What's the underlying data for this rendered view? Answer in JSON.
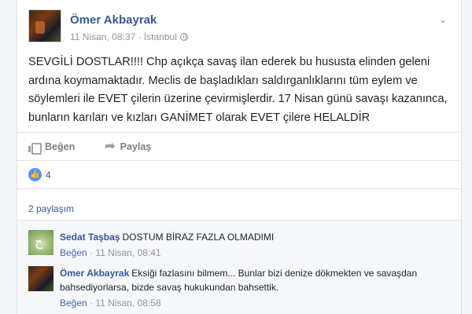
{
  "post": {
    "author": "Ömer Akbayrak",
    "timestamp": "11 Nisan, 08:37",
    "separator": " · ",
    "location": "İstanbul",
    "privacy_icon": "globe-icon",
    "body": "SEVGİLİ DOSTLAR!!!! Chp açıkça savaş ilan ederek bu hususta elinden geleni ardına koymamaktadır. Meclis de başladıkları saldırganlıklarını tüm eylem ve söylemleri ile EVET çilerin üzerine çevirmişlerdir. 17 Nisan günü savaşı kazanınca, bunların karıları ve kızları GANİMET olarak EVET çilere HELALDİR",
    "actions": {
      "like_label": "Beğen",
      "share_label": "Paylaş"
    },
    "reaction_count": "4",
    "shares_label": "2 paylaşım"
  },
  "comments": [
    {
      "author": "Sedat Taşbaş",
      "text": "DOSTUM BİRAZ FAZLA OLMADIMI",
      "like_label": "Beğen",
      "time": "11 Nisan, 08:41"
    },
    {
      "author": "Ömer Akbayrak",
      "text": "Eksiği fazlasını bilmem... Bunlar bizi denize dökmekten ve savaşdan bahsediyorlarsa, bizde savaş hukukundan bahsettik.",
      "like_label": "Beğen",
      "time": "11 Nisan, 08:58"
    }
  ],
  "colors": {
    "link": "#365899",
    "meta": "#90949c",
    "like_badge": "#5890ff"
  }
}
